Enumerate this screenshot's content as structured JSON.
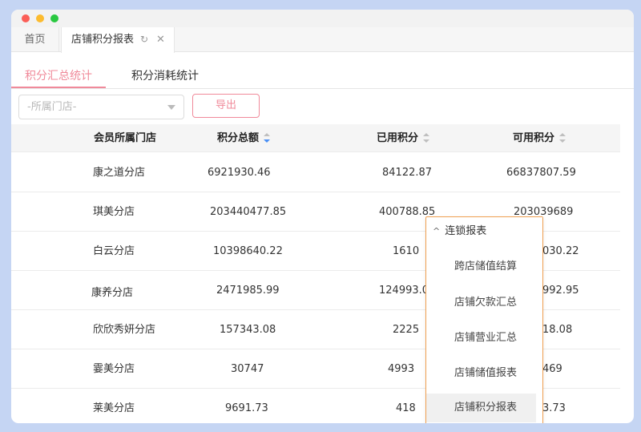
{
  "tabs": {
    "home_label": "首页",
    "active_label": "店铺积分报表",
    "refresh_icon": "↻",
    "close_icon": "✕"
  },
  "subtabs": {
    "summary_label": "积分汇总统计",
    "consume_label": "积分消耗统计"
  },
  "filter": {
    "store_placeholder": "-所属门店-",
    "export_label": "导出"
  },
  "table": {
    "headers": {
      "store": "会员所属门店",
      "total": "积分总额",
      "used": "已用积分",
      "available": "可用积分"
    },
    "rows": [
      {
        "store": "康之道分店",
        "total": "6921930.46",
        "used": "84122.87",
        "available": "66837807.59"
      },
      {
        "store": "琪美分店",
        "total": "203440477.85",
        "used": "400788.85",
        "available": "203039689"
      },
      {
        "store": "白云分店",
        "total": "10398640.22",
        "used": "1610",
        "available": "030.22"
      },
      {
        "store": "康养分店",
        "total": "2471985.99",
        "used": "124993.0",
        "available": "992.95"
      },
      {
        "store": "欣欣秀妍分店",
        "total": "157343.08",
        "used": "2225",
        "available": "18.08"
      },
      {
        "store": "霎美分店",
        "total": "30747",
        "used": "4993",
        "available": "469"
      },
      {
        "store": "莱美分店",
        "total": "9691.73",
        "used": "418",
        "available": "3.73"
      }
    ]
  },
  "dropdown": {
    "group_label": "连锁报表",
    "items": [
      "跨店储值结算",
      "店铺欠款汇总",
      "店铺营业汇总",
      "店铺储值报表",
      "店铺积分报表"
    ],
    "selected_index": 4
  },
  "colors": {
    "accent": "#f08a9a",
    "dropdown_border": "#f0a050",
    "sort_active": "#4a8ff5"
  }
}
